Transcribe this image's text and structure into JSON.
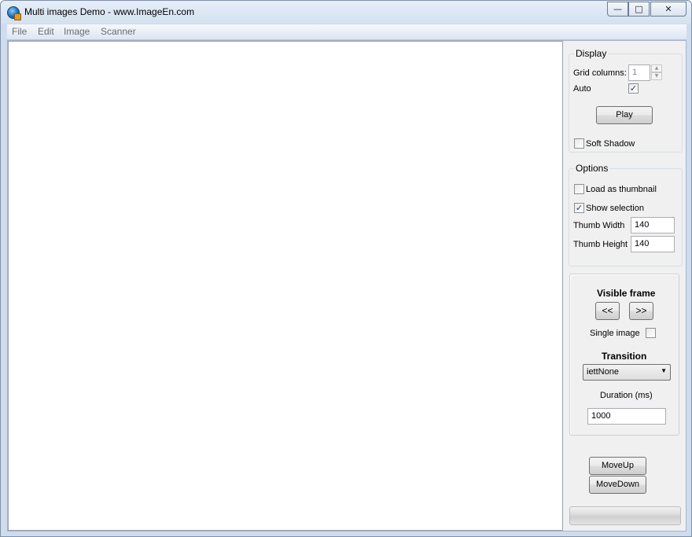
{
  "window": {
    "title": "Multi images Demo - www.ImageEn.com",
    "controls": {
      "minimize": "—",
      "maximize": "□",
      "close": "✕"
    }
  },
  "menu": [
    "File",
    "Edit",
    "Image",
    "Scanner"
  ],
  "display": {
    "legend": "Display",
    "grid_columns_label": "Grid columns:",
    "grid_columns_value": "1",
    "auto_label": "Auto",
    "auto_checked": true,
    "play_label": "Play",
    "soft_shadow_label": "Soft Shadow",
    "soft_shadow_checked": false
  },
  "options": {
    "legend": "Options",
    "load_thumb_label": "Load as thumbnail",
    "load_thumb_checked": false,
    "show_selection_label": "Show selection",
    "show_selection_checked": true,
    "thumb_width_label": "Thumb Width",
    "thumb_width_value": "140",
    "thumb_height_label": "Thumb Height",
    "thumb_height_value": "140"
  },
  "frame": {
    "visible_frame_label": "Visible frame",
    "prev_label": "<<",
    "next_label": ">>",
    "single_image_label": "Single image",
    "single_image_checked": false,
    "transition_label": "Transition",
    "transition_value": "iettNone",
    "duration_label": "Duration (ms)",
    "duration_value": "1000"
  },
  "actions": {
    "move_up_label": "MoveUp",
    "move_down_label": "MoveDown"
  },
  "icons": {
    "app": "app-globe-icon",
    "dropdown": "chevron-down-icon",
    "spin_up": "spin-up-icon",
    "spin_down": "spin-down-icon"
  }
}
